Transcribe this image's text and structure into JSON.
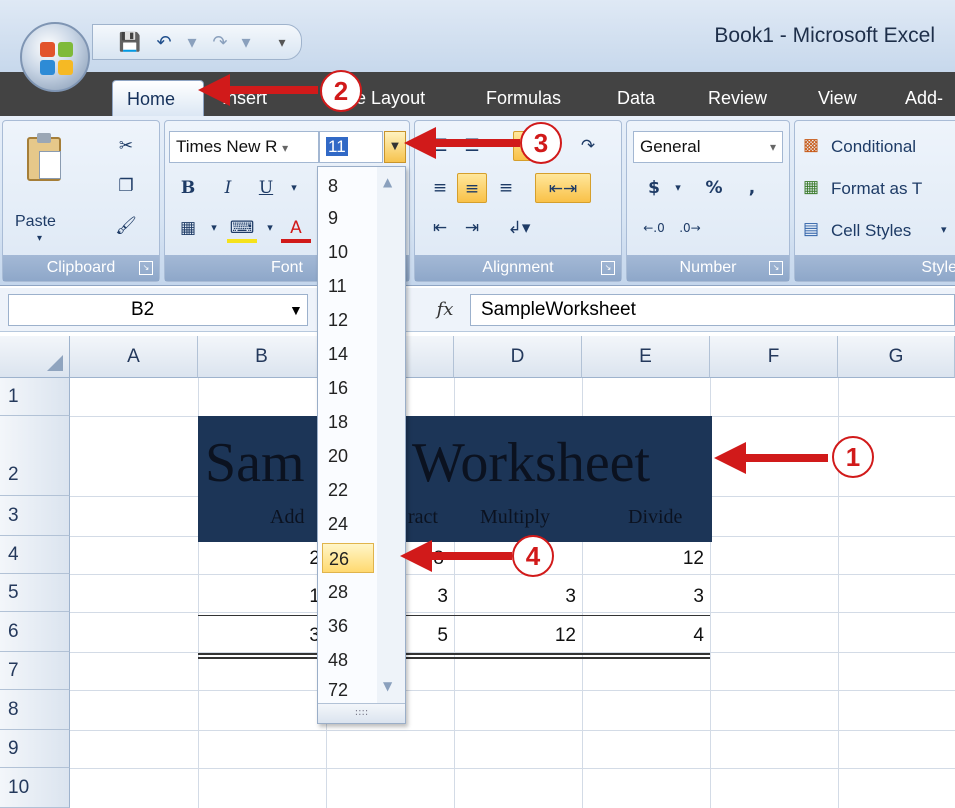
{
  "window": {
    "title": "Book1 - Microsoft Excel"
  },
  "quick_access": [
    {
      "icon": "save-icon"
    },
    {
      "icon": "undo-icon"
    },
    {
      "icon": "redo-icon"
    },
    {
      "icon": "customize-icon"
    }
  ],
  "tabs": [
    "Home",
    "Insert",
    "Page Layout",
    "Formulas",
    "Data",
    "Review",
    "View",
    "Add-"
  ],
  "ribbon": {
    "clipboard": {
      "paste_label": "Paste",
      "group_label": "Clipboard"
    },
    "font": {
      "font_name": "Times New R",
      "font_size": "11",
      "group_label": "Font"
    },
    "alignment": {
      "group_label": "Alignment"
    },
    "number": {
      "format": "General",
      "currency": "$",
      "percent": "%",
      "comma": ",",
      "group_label": "Number"
    },
    "styles": {
      "conditional": "Conditional",
      "format_as": "Format as T",
      "cell_styles": "Cell Styles",
      "group_label": "Style"
    }
  },
  "formula_bar": {
    "name_box": "B2",
    "fx": "fx",
    "value": "SampleWorksheet"
  },
  "columns": [
    "A",
    "B",
    "C",
    "D",
    "E",
    "F",
    "G"
  ],
  "rows": [
    "1",
    "2",
    "3",
    "4",
    "5",
    "6",
    "7",
    "8",
    "9",
    "10"
  ],
  "sheet": {
    "title_visible_left": "Sam",
    "title_visible_right": "Worksheet",
    "headers": [
      "Add",
      "ract",
      "Multiply",
      "Divide"
    ],
    "row4": [
      "2",
      "8",
      "",
      "12"
    ],
    "row5": [
      "1",
      "3",
      "3",
      "3"
    ],
    "row6": [
      "3",
      "5",
      "12",
      "4"
    ]
  },
  "font_size_list": {
    "options": [
      "8",
      "9",
      "10",
      "11",
      "12",
      "14",
      "16",
      "18",
      "20",
      "22",
      "24",
      "26",
      "28",
      "36",
      "48",
      "72"
    ],
    "selected": "26",
    "grip": "::::"
  },
  "annotations": {
    "c1": "1",
    "c2": "2",
    "c3": "3",
    "c4": "4"
  },
  "colors": {
    "accent": "#d11a1a",
    "title_fill": "#1c3557",
    "selection": "#ffd970"
  }
}
